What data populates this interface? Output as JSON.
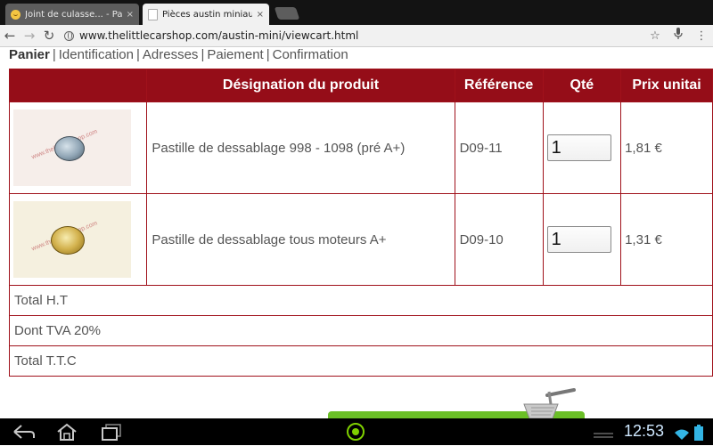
{
  "browser": {
    "tabs": [
      {
        "title": "Joint de culasse... - Pa",
        "close": "×",
        "icon": "smiley-favicon"
      },
      {
        "title": "Pièces austin miniausti",
        "close": "×",
        "icon": "page-favicon"
      }
    ],
    "url": "www.thelittlecarshop.com/austin-mini/viewcart.html",
    "nav": {
      "back": "←",
      "forward": "→",
      "reload": "↻",
      "star": "☆",
      "mic": "🎙",
      "menu": "⋮"
    }
  },
  "checkout_steps": {
    "active": "Panier",
    "items": [
      "Identification",
      "Adresses",
      "Paiement",
      "Confirmation"
    ],
    "separator": "|"
  },
  "cart": {
    "headers": [
      "",
      "Désignation du produit",
      "Référence",
      "Qté",
      "Prix unitai"
    ],
    "rows": [
      {
        "designation": "Pastille de dessablage 998 - 1098 (pré A+)",
        "reference": "D09-11",
        "qty": "1",
        "price": "1,81 €",
        "image": "silver-plug",
        "watermark": "www.thelittlecarshop.com"
      },
      {
        "designation": "Pastille de dessablage tous moteurs A+",
        "reference": "D09-10",
        "qty": "1",
        "price": "1,31 €",
        "image": "gold-plug",
        "watermark": "www.thelittlecarshop.com"
      }
    ],
    "totals": {
      "ht": "Total H.T",
      "tva": "Dont TVA 20%",
      "ttc": "Total T.T.C"
    }
  },
  "system_bar": {
    "time": "12:53"
  },
  "colors": {
    "header_bg": "#950d18",
    "border": "#a0111b",
    "promo_green": "#6bbf27"
  }
}
